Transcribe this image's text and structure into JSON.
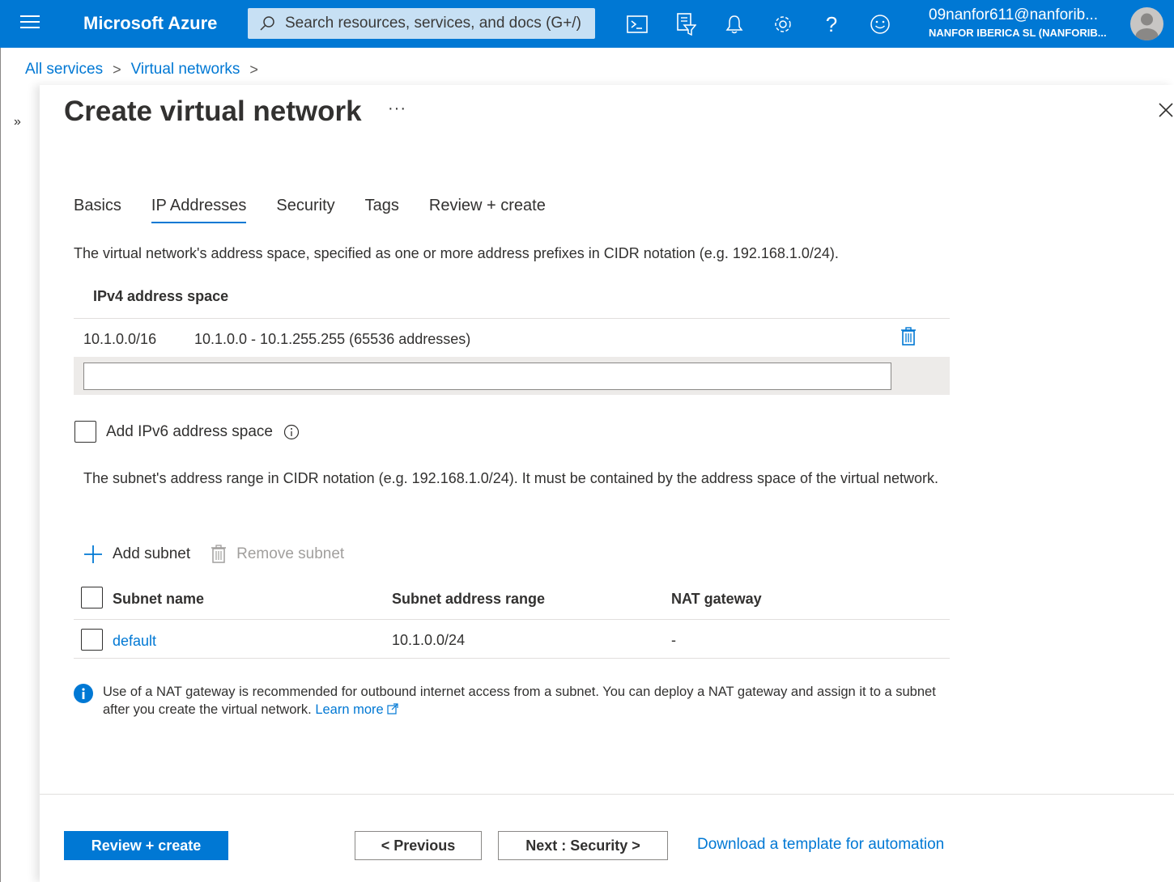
{
  "topbar": {
    "brand": "Microsoft Azure",
    "search_placeholder": "Search resources, services, and docs (G+/)",
    "icons": [
      "cloud-shell-icon",
      "directory-filter-icon",
      "notifications-icon",
      "settings-icon",
      "help-icon",
      "feedback-icon"
    ],
    "account_email": "09nanfor611@nanforib...",
    "account_tenant": "NANFOR IBERICA SL (NANFORIB..."
  },
  "breadcrumb": {
    "items": [
      "All services",
      "Virtual networks"
    ],
    "separator": ">"
  },
  "expander_label": "»",
  "panel": {
    "title": "Create virtual network",
    "more_label": "···",
    "tabs": [
      {
        "label": "Basics",
        "active": false
      },
      {
        "label": "IP Addresses",
        "active": true
      },
      {
        "label": "Security",
        "active": false
      },
      {
        "label": "Tags",
        "active": false
      },
      {
        "label": "Review + create",
        "active": false
      }
    ],
    "address_space_description": "The virtual network's address space, specified as one or more address prefixes in CIDR notation (e.g. 192.168.1.0/24).",
    "ipv4": {
      "header": "IPv4 address space",
      "entries": [
        {
          "cidr": "10.1.0.0/16",
          "range": "10.1.0.0 - 10.1.255.255 (65536 addresses)"
        }
      ],
      "new_value": ""
    },
    "ipv6": {
      "label": "Add IPv6 address space",
      "checked": false
    },
    "subnet_description": "The subnet's address range in CIDR notation (e.g. 192.168.1.0/24). It must be contained by the address space of the virtual network.",
    "toolbar": {
      "add_subnet": "Add subnet",
      "remove_subnet": "Remove subnet"
    },
    "subnets": {
      "columns": [
        "Subnet name",
        "Subnet address range",
        "NAT gateway"
      ],
      "rows": [
        {
          "name": "default",
          "range": "10.1.0.0/24",
          "nat": "-"
        }
      ]
    },
    "info": {
      "text": "Use of a NAT gateway is recommended for outbound internet access from a subnet. You can deploy a NAT gateway and assign it to a subnet after you create the virtual network.",
      "link": "Learn more"
    },
    "footer": {
      "review_create": "Review + create",
      "previous": "< Previous",
      "next": "Next : Security >",
      "download": "Download a template for automation"
    }
  },
  "colors": {
    "accent": "#0078d4",
    "search_bg": "#c7e0f4",
    "text": "#323130"
  }
}
